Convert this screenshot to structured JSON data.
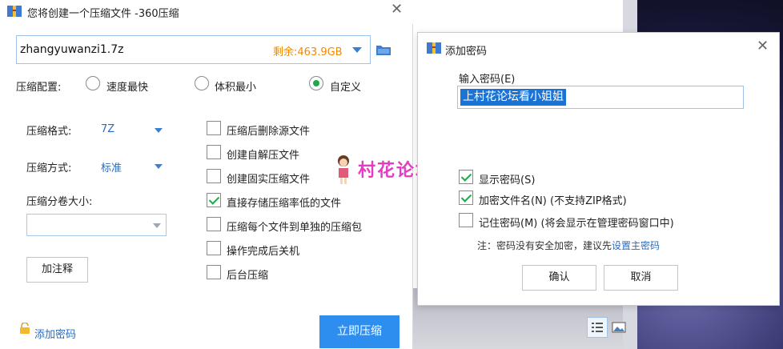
{
  "main_window": {
    "title": "您将创建一个压缩文件 -360压缩",
    "path_value": "zhangyuwanzi1.7z",
    "free_space": "剩余:463.9GB",
    "config_label": "压缩配置:",
    "radios": [
      {
        "label": "速度最快",
        "selected": false
      },
      {
        "label": "体积最小",
        "selected": false
      },
      {
        "label": "自定义",
        "selected": true
      }
    ],
    "format_label": "压缩格式:",
    "format_value": "7Z",
    "method_label": "压缩方式:",
    "method_value": "标准",
    "split_label": "压缩分卷大小:",
    "split_value": "",
    "comment_button": "加注释",
    "checkboxes": [
      {
        "label": "压缩后删除源文件",
        "checked": false
      },
      {
        "label": "创建自解压文件",
        "checked": false
      },
      {
        "label": "创建固实压缩文件",
        "checked": false
      },
      {
        "label": "直接存储压缩率低的文件",
        "checked": true
      },
      {
        "label": "压缩每个文件到单独的压缩包",
        "checked": false
      },
      {
        "label": "操作完成后关机",
        "checked": false
      },
      {
        "label": "后台压缩",
        "checked": false
      }
    ],
    "add_password_link": "添加密码",
    "start_button": "立即压缩"
  },
  "watermark": {
    "text": "村花论坛"
  },
  "password_dialog": {
    "title": "添加密码",
    "input_label": "输入密码(E)",
    "password_value": "上村花论坛看小姐姐",
    "checkboxes": [
      {
        "label": "显示密码(S)",
        "checked": true
      },
      {
        "label": "加密文件名(N) (不支持ZIP格式)",
        "checked": true
      },
      {
        "label": "记住密码(M) (将会显示在管理密码窗口中)",
        "checked": false
      }
    ],
    "note_text": "注：密码没有安全加密，建议先",
    "note_link": "设置主密码",
    "ok_button": "确认",
    "cancel_button": "取消"
  },
  "colors": {
    "accent": "#2d8ef0",
    "link": "#2a6bbf",
    "free_space": "#f08a00",
    "check_green": "#1fa84a",
    "watermark": "#e43cc3",
    "selection": "#1b73d6"
  }
}
